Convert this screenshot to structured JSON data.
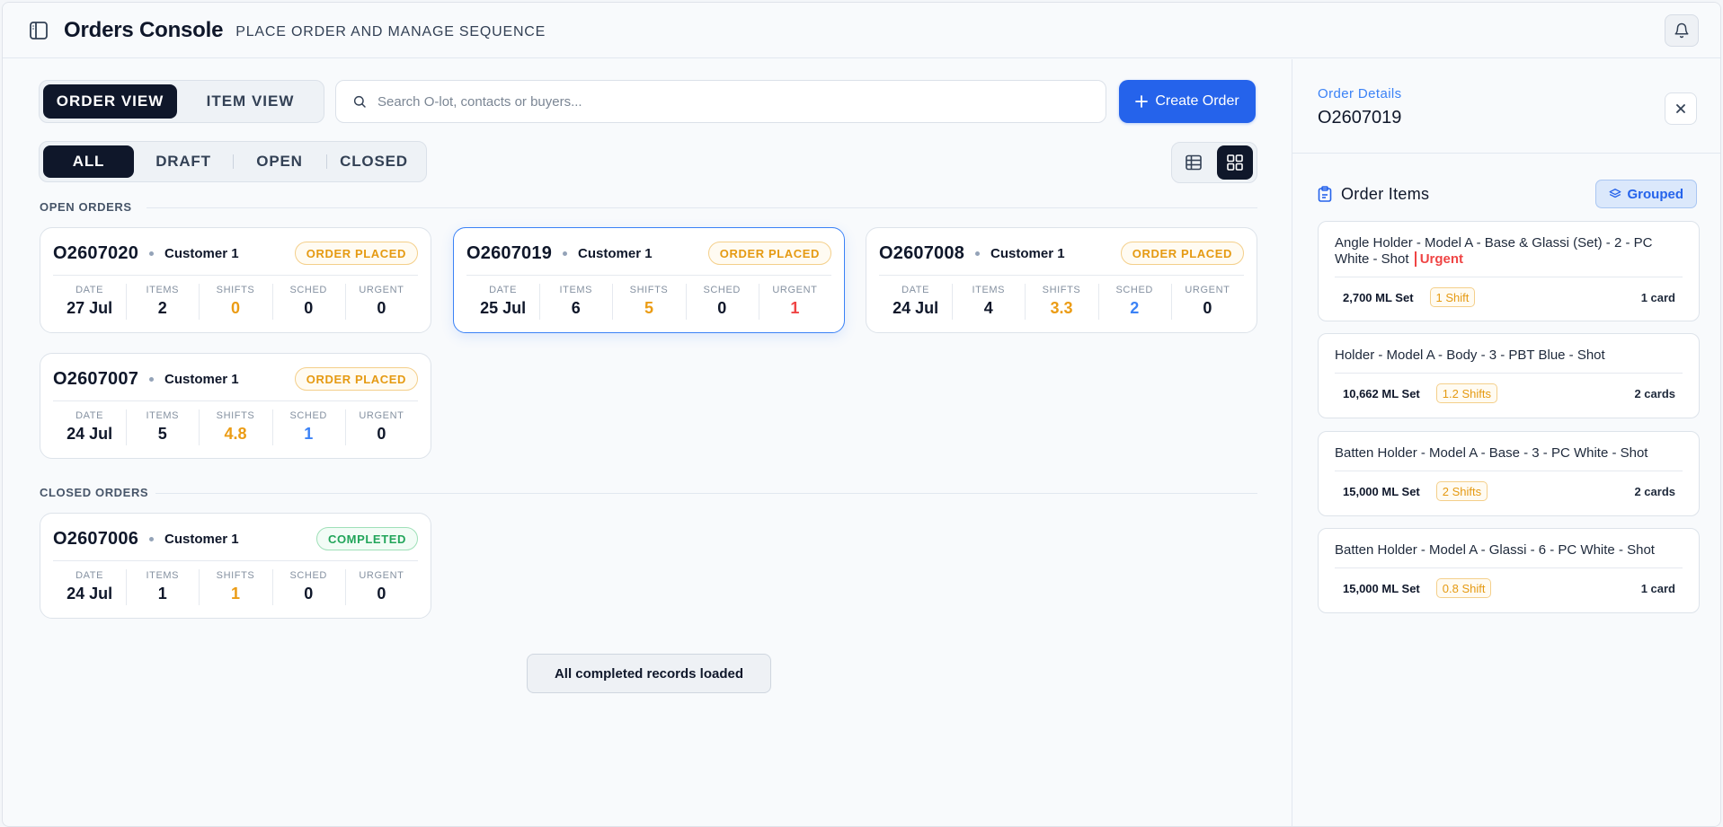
{
  "header": {
    "title": "Orders Console",
    "subtitle": "PLACE ORDER AND MANAGE SEQUENCE"
  },
  "view_toggle": {
    "order_view": "ORDER VIEW",
    "item_view": "ITEM VIEW",
    "active": "order_view"
  },
  "search": {
    "placeholder": "Search O-lot, contacts or buyers...",
    "value": ""
  },
  "create_button": {
    "label": "Create Order"
  },
  "filter_tabs": [
    "ALL",
    "DRAFT",
    "OPEN",
    "CLOSED"
  ],
  "active_filter": "ALL",
  "stat_labels": {
    "date": "DATE",
    "items": "ITEMS",
    "shifts": "SHIFTS",
    "sched": "SCHED",
    "urgent": "URGENT"
  },
  "open_orders": {
    "label": "OPEN ORDERS",
    "orders": [
      {
        "id": "O2607020",
        "customer": "Customer 1",
        "status": "ORDER PLACED",
        "date": "27 Jul",
        "items": "2",
        "shifts": "0",
        "sched": "0",
        "urgent": "0"
      },
      {
        "id": "O2607019",
        "customer": "Customer 1",
        "status": "ORDER PLACED",
        "date": "25 Jul",
        "items": "6",
        "shifts": "5",
        "sched": "0",
        "urgent": "1"
      },
      {
        "id": "O2607008",
        "customer": "Customer 1",
        "status": "ORDER PLACED",
        "date": "24 Jul",
        "items": "4",
        "shifts": "3.3",
        "sched": "2",
        "urgent": "0"
      },
      {
        "id": "O2607007",
        "customer": "Customer 1",
        "status": "ORDER PLACED",
        "date": "24 Jul",
        "items": "5",
        "shifts": "4.8",
        "sched": "1",
        "urgent": "0"
      }
    ]
  },
  "closed_orders": {
    "label": "CLOSED ORDERS",
    "orders": [
      {
        "id": "O2607006",
        "customer": "Customer 1",
        "status": "COMPLETED",
        "date": "24 Jul",
        "items": "1",
        "shifts": "1",
        "sched": "0",
        "urgent": "0"
      }
    ]
  },
  "loaded_message": "All completed records loaded",
  "details": {
    "label": "Order Details",
    "order_id": "O2607019",
    "items_title": "Order Items",
    "grouped_label": "Grouped",
    "items": [
      {
        "name": "Angle Holder - Model A - Base & Glassi (Set) - 2 - PC White - Shot",
        "urgent": "Urgent",
        "qty": "2,700 ML Set",
        "shift": "1 Shift",
        "cards": "1 card"
      },
      {
        "name": "Holder - Model A - Body - 3 - PBT Blue - Shot",
        "qty": "10,662 ML Set",
        "shift": "1.2 Shifts",
        "cards": "2 cards"
      },
      {
        "name": "Batten Holder - Model A - Base - 3 - PC White - Shot",
        "qty": "15,000 ML Set",
        "shift": "2 Shifts",
        "cards": "2 cards"
      },
      {
        "name": "Batten Holder - Model A - Glassi - 6 - PC White - Shot",
        "qty": "15,000 ML Set",
        "shift": "0.8 Shift",
        "cards": "1 card"
      }
    ]
  },
  "colors": {
    "primary": "#2563eb",
    "dark": "#0f172a",
    "order_placed": "#e59a12",
    "completed": "#22a55a",
    "urgent": "#ef4444"
  }
}
